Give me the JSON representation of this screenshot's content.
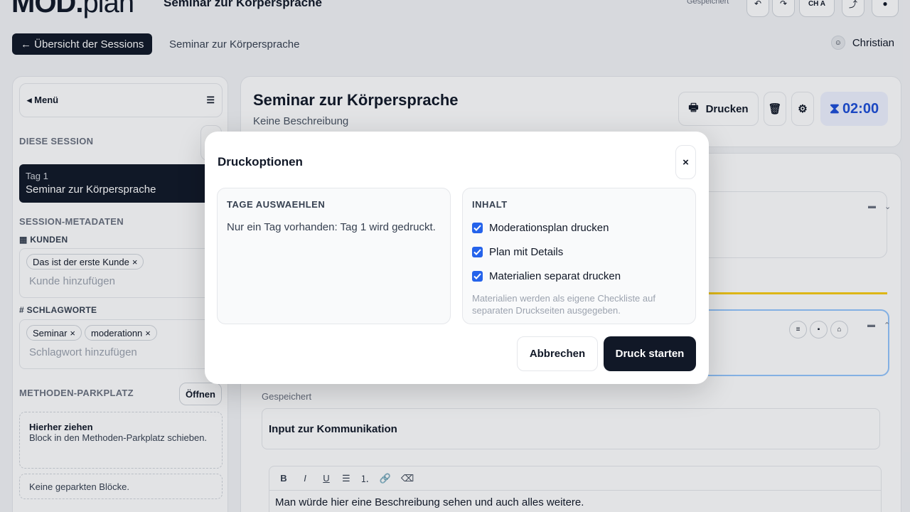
{
  "app": {
    "logo_bold": "MOD.",
    "logo_light": "plan",
    "title": "Seminar zur Körpersprache",
    "saved_status": "Gespeichert",
    "lang_label": "CH A"
  },
  "nav": {
    "back_label": "← Übersicht der Sessions",
    "breadcrumb": "Seminar zur Körpersprache",
    "user_name": "Christian"
  },
  "sidebar": {
    "menu_label": "◂ Menü",
    "section_this_session": "DIESE SESSION",
    "session": {
      "day": "Tag 1",
      "name": "Seminar zur Körpersprache"
    },
    "section_meta": "SESSION-METADATEN",
    "customers_label": "KUNDEN",
    "customers": [
      "Das ist der erste Kunde"
    ],
    "customers_placeholder": "Kunde hinzufügen",
    "tags_label": "SCHLAGWORTE",
    "tags": [
      "Seminar",
      "moderationn"
    ],
    "tags_placeholder": "Schlagwort hinzufügen",
    "parking_label": "METHODEN-PARKPLATZ",
    "parking_open": "Öffnen",
    "parking_drop_title": "Hierher ziehen",
    "parking_drop_text": "Block in den Methoden-Parkplatz schieben.",
    "parking_empty": "Keine geparkten Blöcke."
  },
  "main": {
    "title": "Seminar zur Körpersprache",
    "description": "Keine Beschreibung",
    "print_label": "Drucken",
    "timer": "02:00",
    "saved_label": "Gespeichert",
    "block_title": "Input zur Kommunikation",
    "editor_text": "Man würde hier eine Beschreibung sehen und auch alles weitere."
  },
  "modal": {
    "title": "Druckoptionen",
    "close_label": "×",
    "days_heading": "TAGE AUSWAEHLEN",
    "days_text": "Nur ein Tag vorhanden: Tag 1 wird gedruckt.",
    "content_heading": "INHALT",
    "options": [
      {
        "label": "Moderationsplan drucken",
        "checked": true
      },
      {
        "label": "Plan mit Details",
        "checked": true
      },
      {
        "label": "Materialien separat drucken",
        "checked": true
      }
    ],
    "hint": "Materialien werden als eigene Checkliste auf separaten Druckseiten ausgegeben.",
    "cancel_label": "Abbrechen",
    "start_label": "Druck starten"
  },
  "colors": {
    "primary_dark": "#111827",
    "accent_blue": "#2563eb",
    "timer_blue": "#1d4ed8",
    "highlight_yellow": "#facc15"
  }
}
